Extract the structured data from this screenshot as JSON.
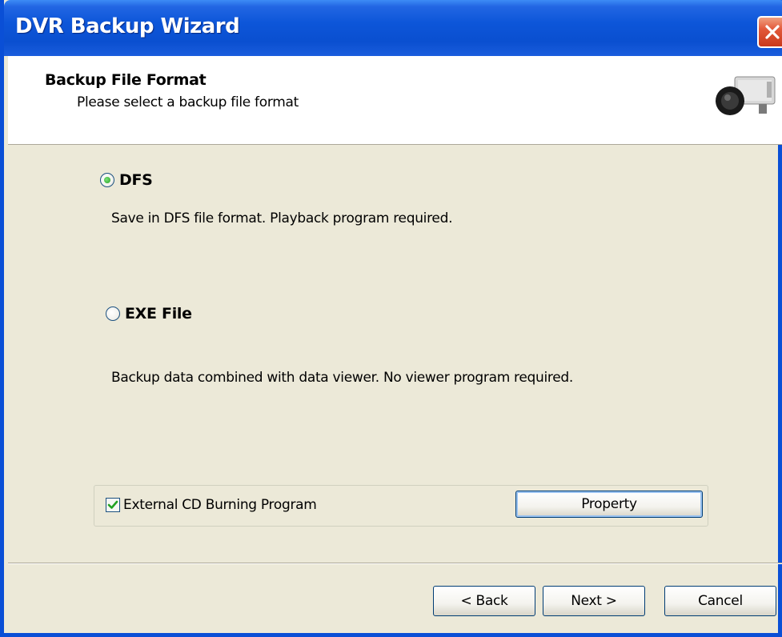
{
  "window": {
    "title": "DVR Backup Wizard"
  },
  "header": {
    "title": "Backup File Format",
    "subtitle": "Please select a backup file format",
    "icon": "camera-icon"
  },
  "options": [
    {
      "label": "DFS",
      "description": "Save in DFS file format. Playback program required.",
      "selected": true
    },
    {
      "label": "EXE File",
      "description": "Backup data combined with data viewer. No viewer program required.",
      "selected": false
    }
  ],
  "external_cd": {
    "label": "External CD Burning Program",
    "checked": true,
    "property_label": "Property"
  },
  "footer": {
    "back_label": "< Back",
    "next_label": "Next >",
    "cancel_label": "Cancel"
  },
  "colors": {
    "titlebar": "#0a4fd6",
    "dialog_bg": "#ece9d8",
    "close_button": "#e2593a",
    "radio_dot": "#21a121"
  }
}
